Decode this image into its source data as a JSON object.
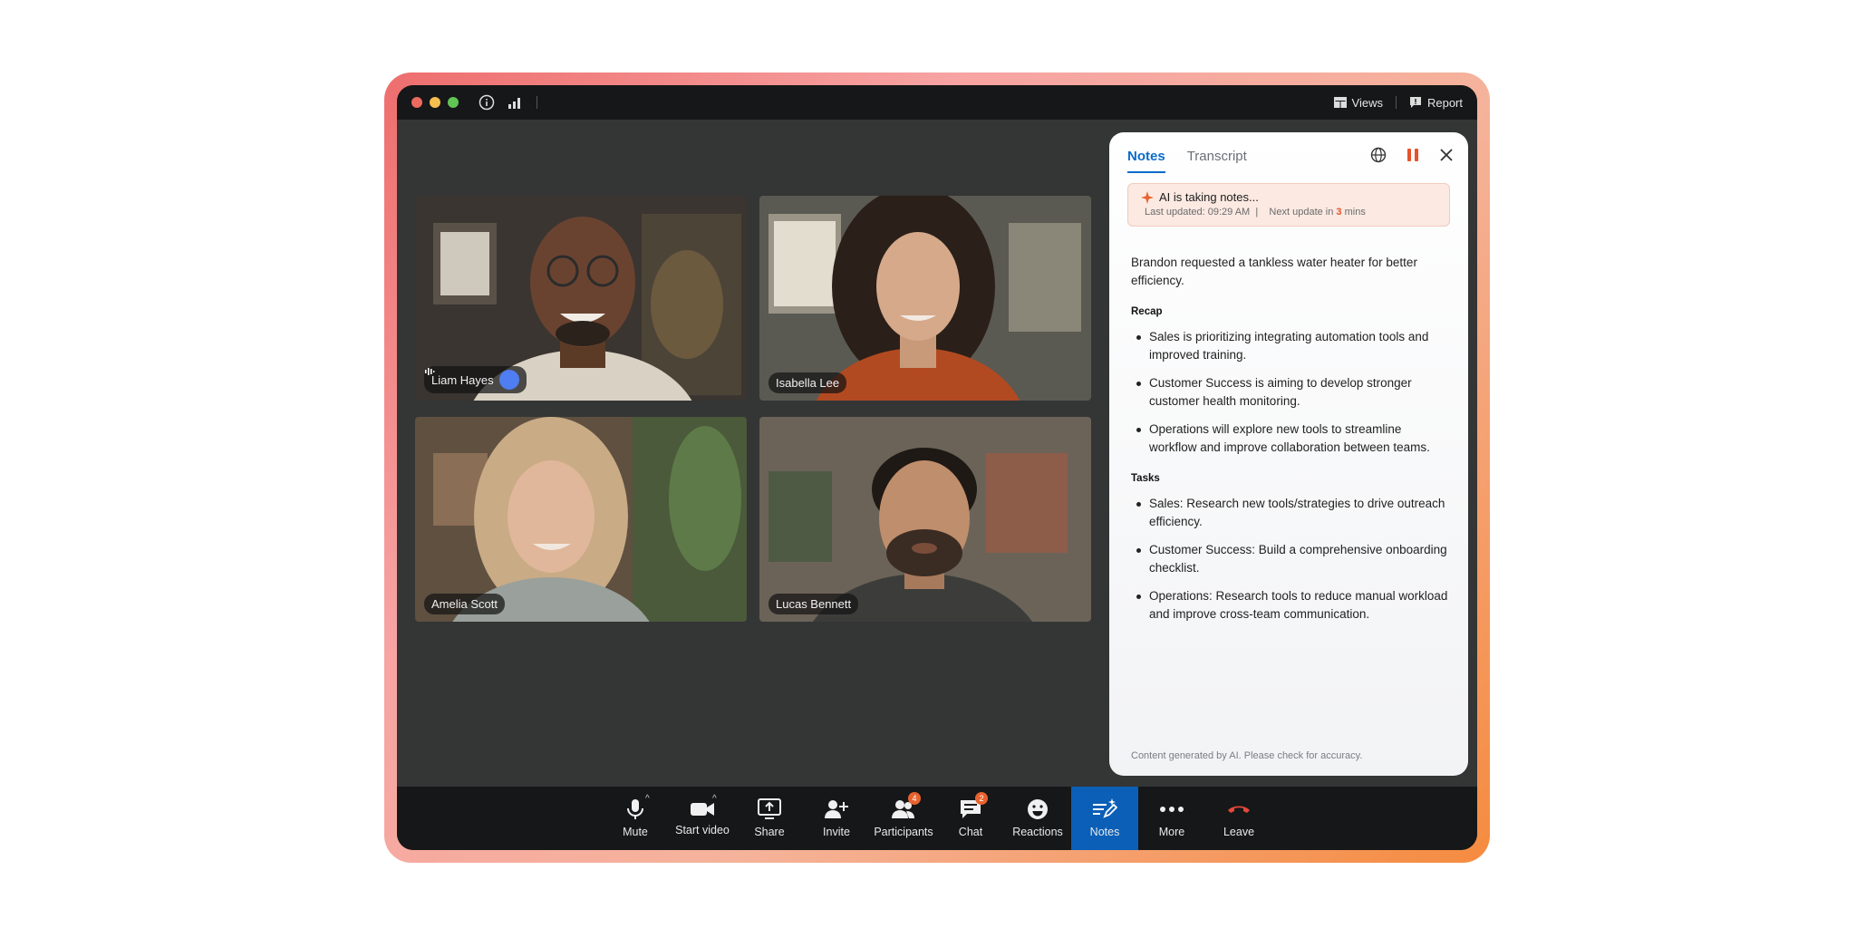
{
  "titlebar": {
    "views_label": "Views",
    "report_label": "Report",
    "traffic_lights": [
      "#ed6a5e",
      "#f5bf4f",
      "#61c554"
    ]
  },
  "participants": [
    {
      "name": "Liam Hayes",
      "speaking": true
    },
    {
      "name": "Isabella Lee",
      "speaking": false
    },
    {
      "name": "Amelia Scott",
      "speaking": false
    },
    {
      "name": "Lucas Bennett",
      "speaking": false
    }
  ],
  "panel": {
    "tabs": [
      {
        "label": "Notes",
        "active": true
      },
      {
        "label": "Transcript",
        "active": false
      }
    ],
    "banner": {
      "title": "AI is taking notes...",
      "last_updated": "Last updated: 09:29 AM",
      "separator": "|",
      "next_update_prefix": "Next update in",
      "next_update_value": "3",
      "next_update_suffix": "mins"
    },
    "summary": "Brandon requested a tankless water heater for better efficiency.",
    "recap_title": "Recap",
    "recap": [
      "Sales is prioritizing integrating automation tools and improved training.",
      "Customer Success is aiming to develop stronger customer health monitoring.",
      "Operations will explore new tools to streamline workflow and improve collaboration between teams."
    ],
    "tasks_title": "Tasks",
    "tasks": [
      "Sales: Research new tools/strategies to drive outreach efficiency.",
      "Customer Success: Build a comprehensive onboarding checklist.",
      "Operations: Research tools to reduce manual workload and improve cross-team communication."
    ],
    "disclaimer": "Content generated by AI. Please check for accuracy."
  },
  "toolbar": {
    "mute": "Mute",
    "start_video": "Start video",
    "share": "Share",
    "invite": "Invite",
    "participants": "Participants",
    "participants_badge": "4",
    "chat": "Chat",
    "chat_badge": "2",
    "reactions": "Reactions",
    "notes": "Notes",
    "more": "More",
    "leave": "Leave"
  },
  "colors": {
    "accent": "#0b6bcb",
    "notes_active": "#0b5fb6",
    "leave_red": "#e5483a",
    "pause_orange": "#e8522a",
    "speaking_blue": "#4f7df2"
  }
}
